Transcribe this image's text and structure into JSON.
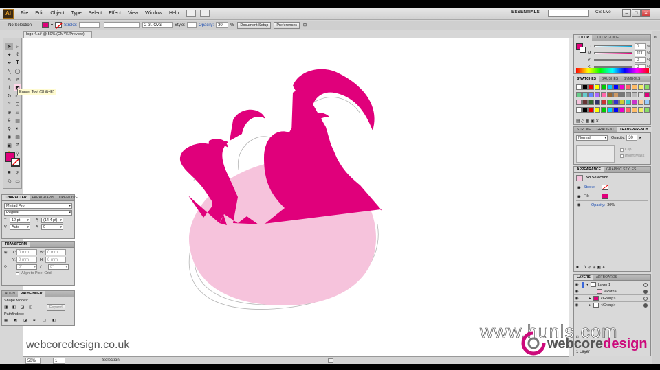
{
  "menu": {
    "logo": "Ai",
    "items": [
      "File",
      "Edit",
      "Object",
      "Type",
      "Select",
      "Effect",
      "View",
      "Window",
      "Help"
    ],
    "workspace": "ESSENTIALS",
    "cslive": "CS Live",
    "window_buttons": [
      "–",
      "□",
      "✕"
    ]
  },
  "control": {
    "selection": "No Selection",
    "stroke_label": "Stroke:",
    "brush": "2 pt. Oval",
    "style_label": "Style:",
    "opacity_label": "Opacity:",
    "opacity_value": "30",
    "opacity_unit": "%",
    "doc_setup": "Document Setup",
    "preferences": "Preferences"
  },
  "document": {
    "tab": "logo 4.ai* @ 50% (CMYK/Preview)",
    "zoom": "50%",
    "page": "1",
    "status": "Selection"
  },
  "tools": {
    "tooltip": "Eraser Tool (Shift+E)"
  },
  "character": {
    "tab1": "CHARACTER",
    "tab2": "PARAGRAPH",
    "tab3": "OPENTYPE",
    "font": "Myriad Pro",
    "style": "Regular",
    "size": "12 pt",
    "leading": "(14.4 pt)",
    "kerning": "Auto",
    "tracking": "0"
  },
  "transform": {
    "tab": "TRANSFORM",
    "x_label": "X:",
    "x": "0 mm",
    "y_label": "Y:",
    "y": "0 mm",
    "w_label": "W:",
    "w": "0 mm",
    "h_label": "H:",
    "h": "0 mm",
    "rotate": "0°",
    "shear": "0°",
    "align": "Align to Pixel Grid"
  },
  "pathfinder": {
    "tab1": "ALIGN",
    "tab2": "PATHFINDER",
    "shape_modes": "Shape Modes:",
    "expand": "Expand",
    "pathfinders": "Pathfinders:"
  },
  "color_panel": {
    "tab1": "COLOR",
    "tab2": "COLOR GUIDE",
    "rows": [
      {
        "label": "C",
        "value": "0",
        "color": "#00a9e0"
      },
      {
        "label": "M",
        "value": "100",
        "color": "#e0007b"
      },
      {
        "label": "Y",
        "value": "0",
        "color": "#ffe800"
      },
      {
        "label": "K",
        "value": "0",
        "color": "#222222"
      }
    ],
    "unit": "%"
  },
  "swatches": {
    "tab1": "SWATCHES",
    "tab2": "BRUSHES",
    "tab3": "SYMBOLS"
  },
  "transparency": {
    "tab1": "STROKE",
    "tab2": "GRADIENT",
    "tab3": "TRANSPARENCY",
    "mode": "Normal",
    "opacity_label": "Opacity:",
    "opacity": "30",
    "clip": "Clip",
    "invert": "Invert Mask"
  },
  "appearance": {
    "tab1": "APPEARANCE",
    "tab2": "GRAPHIC STYLES",
    "title": "No Selection",
    "stroke": "Stroke:",
    "fill": "Fill:",
    "opacity": "Opacity:",
    "opacity_value": "30%"
  },
  "layers": {
    "tab1": "LAYERS",
    "tab2": "ARTBOARDS",
    "rows": [
      "Layer 1",
      "<Path>",
      "<Group>",
      "<Group>"
    ],
    "footer": "1 Layer"
  },
  "watermarks": {
    "left": "webcoredesign.co.uk",
    "hunls": "www.hunls.com",
    "brand_a": "webcore",
    "brand_b": "design"
  },
  "colors": {
    "accent": "#e0007b",
    "light_pink": "#f6c3dc"
  }
}
